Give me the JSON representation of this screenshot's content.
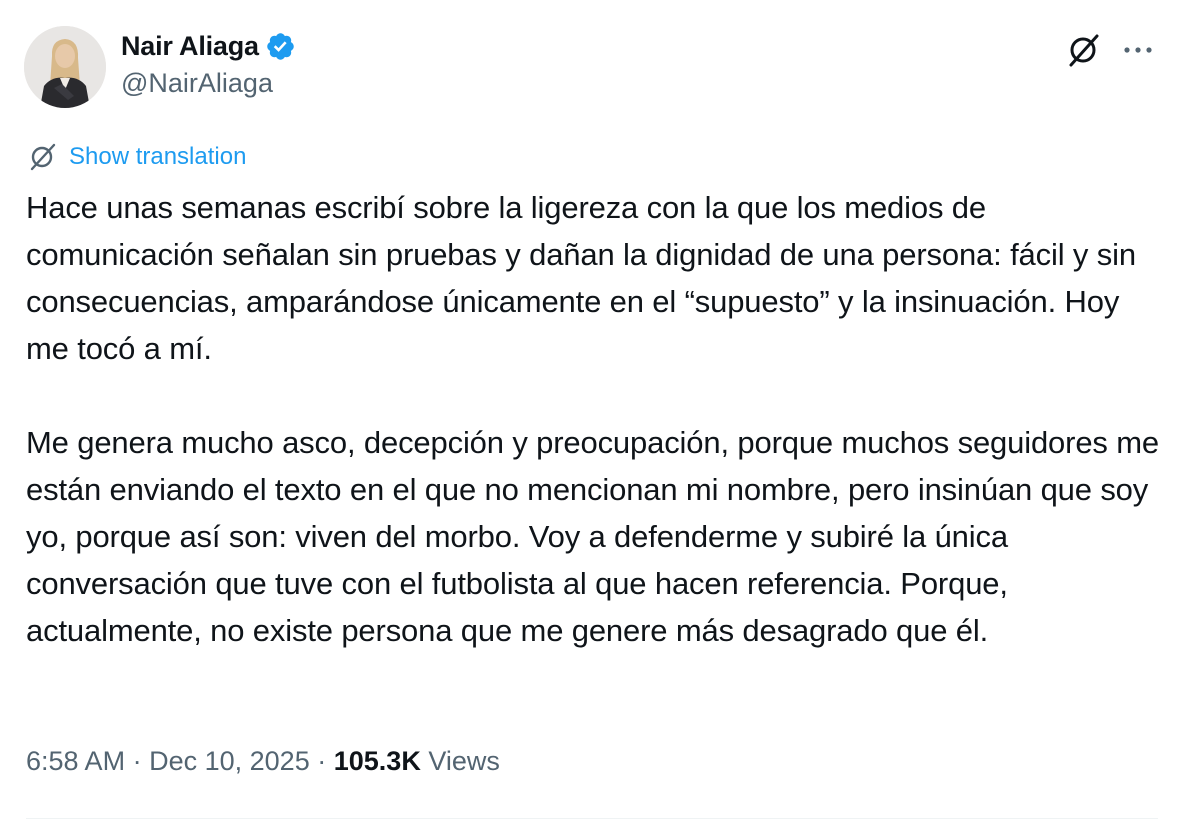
{
  "author": {
    "display_name": "Nair Aliaga",
    "handle": "@NairAliaga",
    "verified": true,
    "avatar_icon": "profile-photo"
  },
  "actions": {
    "grok_icon": "grok-icon",
    "more_icon": "more-dots-icon"
  },
  "translation": {
    "icon": "grok-translate-icon",
    "label": "Show translation"
  },
  "tweet": {
    "paragraphs": [
      "Hace unas semanas escribí sobre la ligereza con la que los medios de comunicación señalan sin pruebas y dañan la dignidad de una persona: fácil y sin consecuencias, amparándose únicamente en el “supuesto” y la insinuación. Hoy me tocó a mí.",
      "Me genera mucho asco, decepción y preocupación, porque muchos seguidores me están enviando el texto en el que no mencionan mi nombre, pero insinúan que soy yo, porque así son: viven del morbo. Voy a defenderme y subiré la única conversación que tuve con el futbolista al que hacen referencia. Porque, actualmente, no existe persona que me genere más desagrado que él."
    ]
  },
  "meta": {
    "time": "6:58 AM",
    "separator": "·",
    "date": "Dec 10, 2025",
    "views_count": "105.3K",
    "views_label": "Views"
  },
  "colors": {
    "text": "#0f1419",
    "secondary": "#536471",
    "accent": "#1d9bf0",
    "divider": "#eff3f4"
  }
}
